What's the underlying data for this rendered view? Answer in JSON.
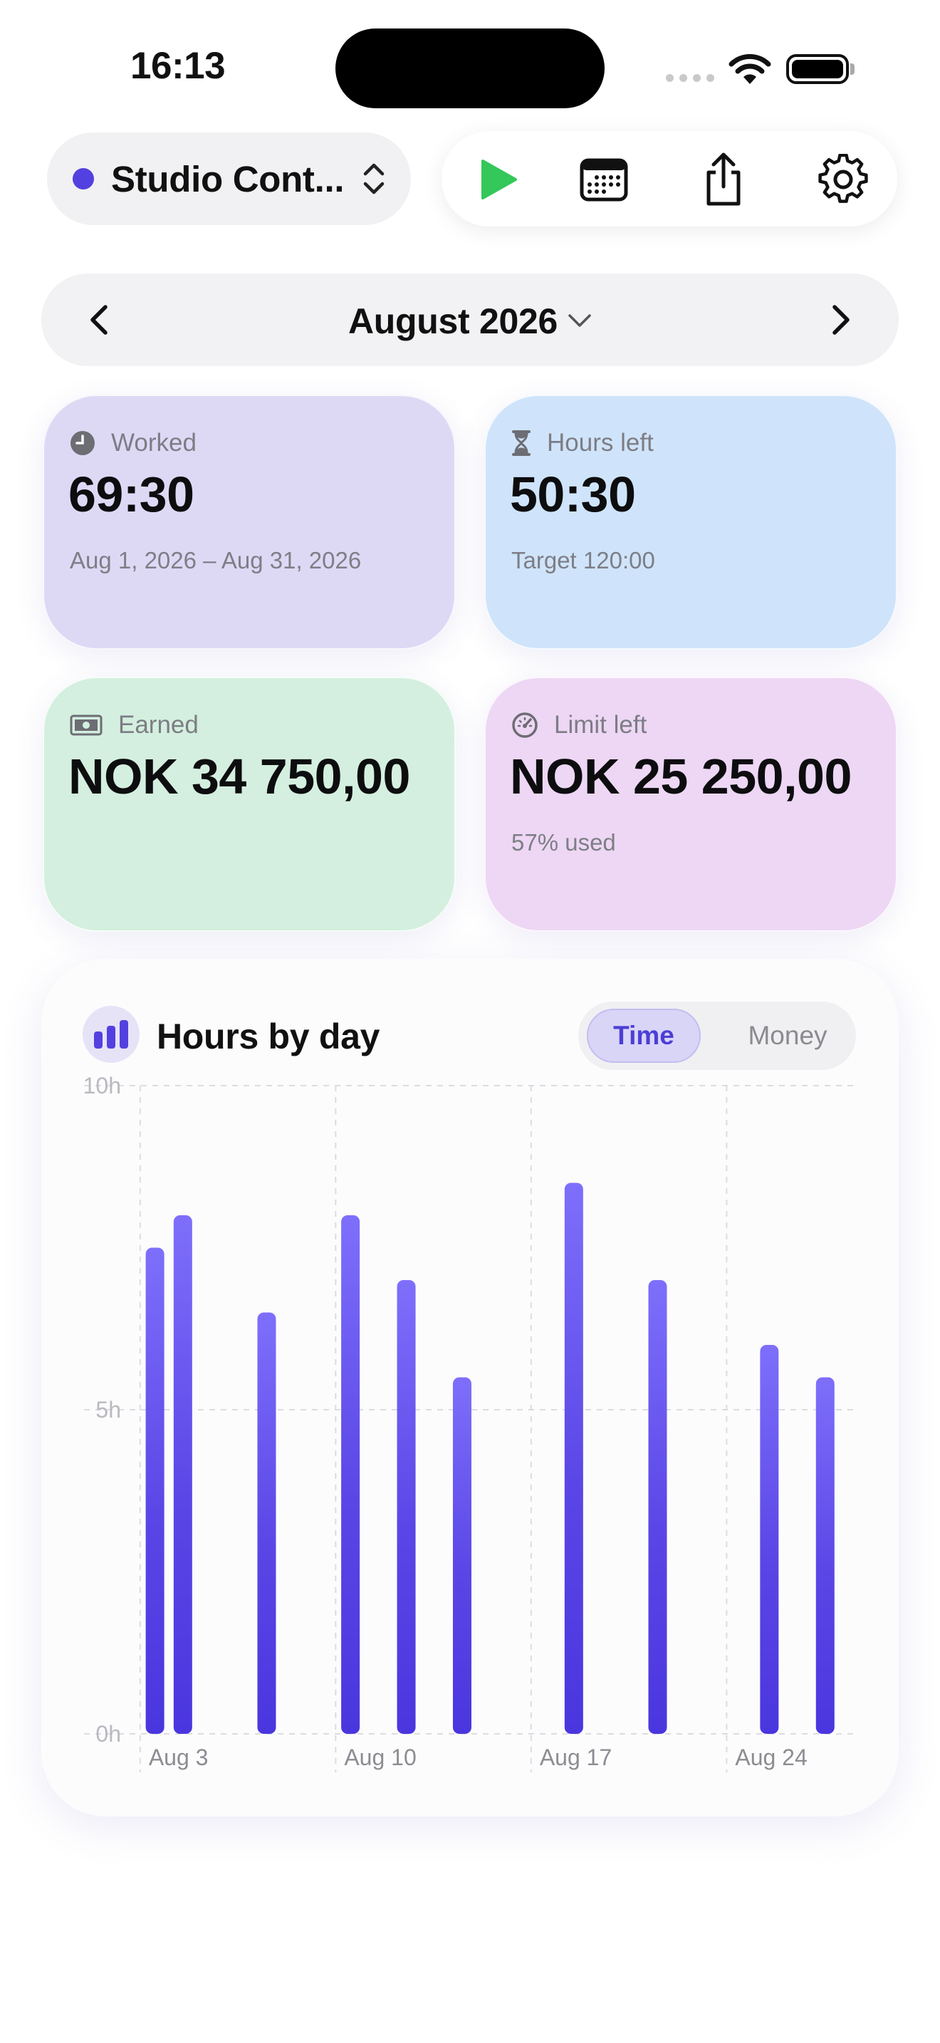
{
  "status": {
    "time": "16:13"
  },
  "client": {
    "name": "Studio Cont...",
    "color": "#5340e0"
  },
  "toolbar": {
    "play_icon": "play-icon",
    "calendar_icon": "calendar-icon",
    "share_icon": "share-icon",
    "settings_icon": "gear-icon"
  },
  "month": {
    "title": "August 2026"
  },
  "cards": {
    "worked": {
      "label": "Worked",
      "value": "69:30",
      "sub": "Aug 1, 2026 – Aug 31, 2026",
      "color": "#ddd9f5"
    },
    "hours_left": {
      "label": "Hours left",
      "value": "50:30",
      "sub": "Target 120:00",
      "color": "#cfe4fa"
    },
    "earned": {
      "label": "Earned",
      "value": "NOK 34 750,00",
      "sub": "",
      "color": "#d4efdf"
    },
    "limit_left": {
      "label": "Limit left",
      "value": "NOK 25 250,00",
      "sub": "57% used",
      "color": "#edd7f4"
    }
  },
  "chart": {
    "title": "Hours by day",
    "toggle": {
      "time": "Time",
      "money": "Money",
      "selected": "Time"
    },
    "bar_color": "#5a46e6"
  },
  "chart_data": {
    "type": "bar",
    "title": "Hours by day",
    "x": [
      2,
      3,
      6,
      9,
      11,
      13,
      17,
      20,
      24,
      26
    ],
    "x_unit": "day of August 2026",
    "values": [
      7.5,
      8.0,
      6.5,
      8.0,
      7.0,
      5.5,
      8.5,
      7.0,
      6.0,
      5.5
    ],
    "y_ticks": [
      "0h",
      "5h",
      "10h"
    ],
    "x_ticks": [
      "Aug 3",
      "Aug 10",
      "Aug 17",
      "Aug 24"
    ],
    "x_tick_days": [
      3,
      10,
      17,
      24
    ],
    "ylim": [
      0,
      10
    ],
    "xlim": [
      1.5,
      27
    ],
    "grid": true
  }
}
